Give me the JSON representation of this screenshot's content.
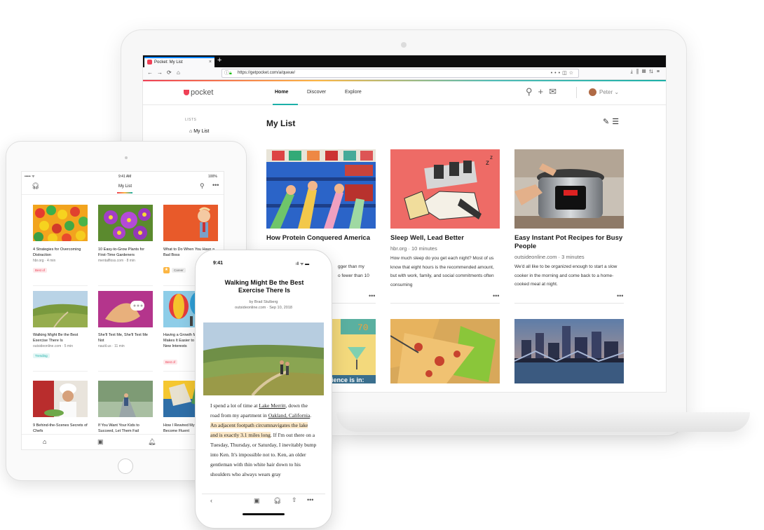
{
  "browser": {
    "tab_title": "Pocket: My List",
    "tab_close": "×",
    "new_tab": "+",
    "url": "https://getpocket.com/a/queue/",
    "nav_back": "←",
    "nav_forward": "→",
    "nav_reload": "⟳",
    "nav_home": "⌂"
  },
  "pocket": {
    "logo_text": "pocket",
    "nav": [
      "Home",
      "Discover",
      "Explore"
    ],
    "user_name": "Peter",
    "lists_label": "LISTS",
    "sidebar_mylist": "My List",
    "page_title": "My List",
    "cards": [
      {
        "title": "How Protein Conquered America",
        "meta": "",
        "excerpt": ""
      },
      {
        "title": "Sleep Well, Lead Better",
        "meta": "hbr.org · 10 minutes",
        "excerpt": "How much sleep do you get each night? Most of us know that eight hours is the recommended amount, but with work, family, and social commitments often consuming"
      },
      {
        "title": "Easy Instant Pot Recipes for Busy People",
        "meta": "outsideonline.com · 3 minutes",
        "excerpt": "We'd all like to be organized enough to start a slow cooker in the morning and come back to a home-cooked meal at night."
      }
    ],
    "card1_peek": [
      "gger than my",
      "o fewer than 10"
    ],
    "card_more": "•••"
  },
  "tablet": {
    "status_time": "9:41 AM",
    "status_battery": "100%",
    "status_left": "••••• ᯤ",
    "title": "My List",
    "items": [
      {
        "title": "4 Strategies for Overcoming Distraction",
        "meta": "hbr.org · 4 min",
        "badge": "Best of"
      },
      {
        "title": "10 Easy-to-Grow Plants for First-Time Gardeners",
        "meta": "mentalfloss.com · 8 min",
        "badge": ""
      },
      {
        "title": "What to Do When You Have a Bad Boss",
        "meta": "",
        "badge": "Career"
      },
      {
        "title": "Walking Might Be the Best Exercise There Is",
        "meta": "outsideonline.com · 5 min",
        "badge": "Trending"
      },
      {
        "title": "She'll Text Me, She'll Text Me Not",
        "meta": "nautil.us · 11 min",
        "badge": ""
      },
      {
        "title": "Having a Growth Mindset Makes It Easier to Develop New Interests",
        "meta": "",
        "badge": "Best of"
      },
      {
        "title": "9 Behind-the-Scenes Secrets of Chefs",
        "meta": "",
        "badge": ""
      },
      {
        "title": "If You Want Your Kids to Succeed, Let Them Fail",
        "meta": "",
        "badge": ""
      },
      {
        "title": "How I Rewired My Brain to Become Fluent",
        "meta": "",
        "badge": ""
      }
    ]
  },
  "phone": {
    "time": "9:41",
    "status": "ıll ᯤ ▬",
    "headline": "Walking Might Be the Best Exercise There Is",
    "byline": "by Brad Stulberg",
    "source": "outsideonline.com · Sep 10, 2018",
    "body": {
      "p1": "I spend a lot of time at ",
      "link1": "Lake Merritt",
      "p2": ", down the road from my apartment in ",
      "link2": "Oakland, California",
      "p3": ". ",
      "highlight": "An adjacent footpath circumnavigates the lake and is exactly 3.1 miles long",
      "p4": ". If I'm out there on a Tuesday, Thursday, or Saturday, I inevitably bump into Ken. It's impossible not to. Ken, an older gentleman with thin white hair down to his shoulders who always wears gray"
    }
  },
  "colors": {
    "pocket_red": "#ef4056",
    "pocket_teal": "#1cb0a8",
    "highlight": "#fbe7c6"
  }
}
